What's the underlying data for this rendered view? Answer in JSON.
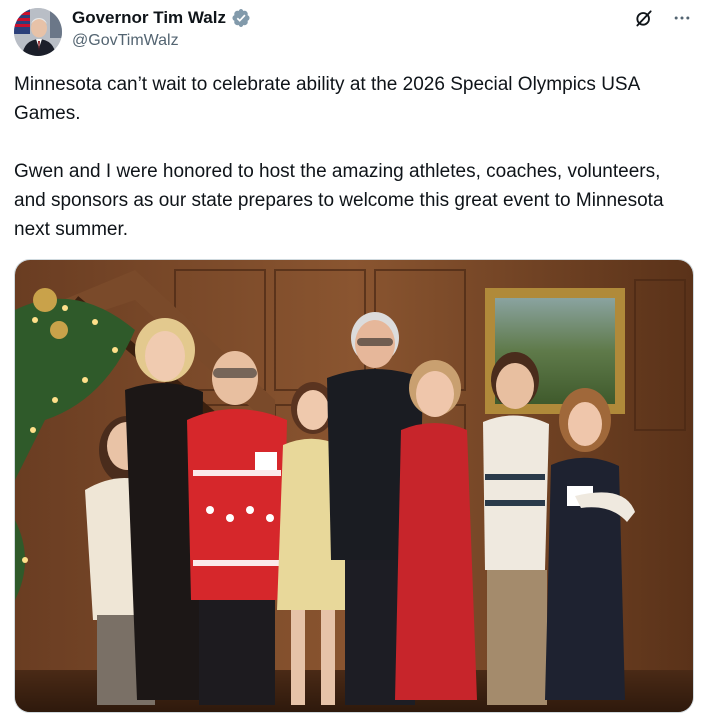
{
  "author": {
    "display_name": "Governor Tim Walz",
    "handle": "@GovTimWalz",
    "verified_icon": "verified-badge-icon",
    "avatar_icon": "profile-avatar"
  },
  "header_actions": {
    "grok_icon": "grok-icon",
    "more_icon": "more-options-icon"
  },
  "tweet": {
    "paragraph_1": "Minnesota can’t wait to celebrate ability at the 2026 Special Olympics USA Games.",
    "paragraph_2": "Gwen and I were honored to host the amazing athletes, coaches, volunteers, and sponsors as our state prepares to welcome this great event to Minnesota next summer."
  },
  "media": {
    "type": "photo"
  },
  "colors": {
    "text_primary": "#0f1419",
    "text_secondary": "#536471",
    "verified_blue": "#1d9bf0",
    "border": "#cfd9de"
  }
}
